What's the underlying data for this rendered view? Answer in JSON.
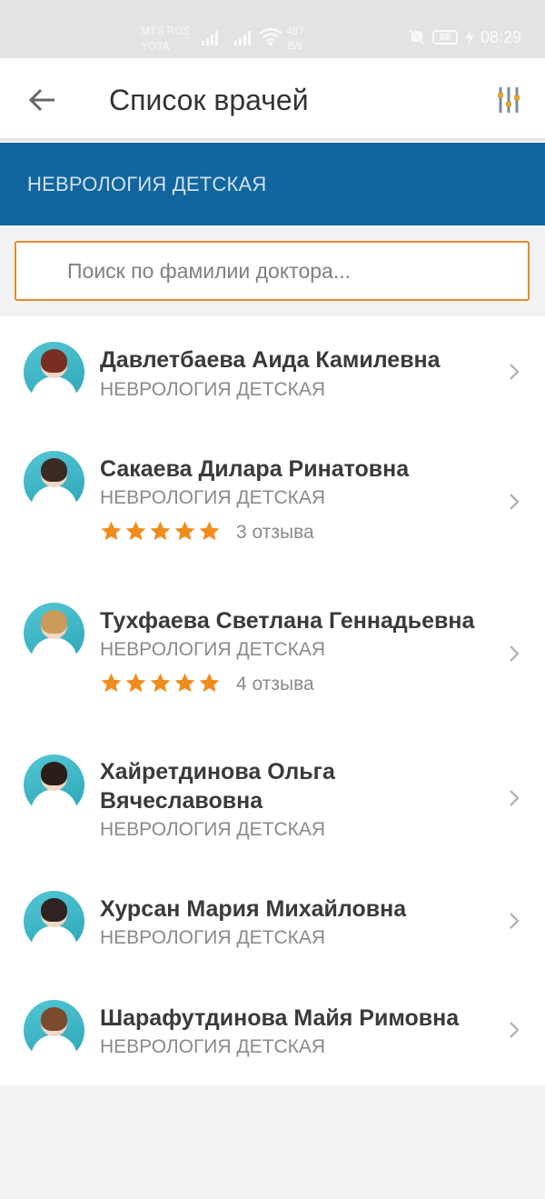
{
  "status_bar": {
    "carrier_line1": "MTS RUS",
    "carrier_line2": "YOTA",
    "speed_value": "487",
    "speed_unit": "B/s",
    "battery": "88",
    "time": "08:29"
  },
  "app_bar": {
    "title": "Список врачей",
    "back_icon": "arrow-left-icon",
    "filter_icon": "filter-sliders-icon"
  },
  "section": {
    "title": "НЕВРОЛОГИЯ ДЕТСКАЯ"
  },
  "search": {
    "placeholder": "Поиск по фамилии доктора..."
  },
  "colors": {
    "accent_blue": "#11669e",
    "accent_orange": "#e58a2c",
    "star": "#f08c1c"
  },
  "doctors": [
    {
      "name": "Давлетбаева Аида Камилевна",
      "specialty": "НЕВРОЛОГИЯ ДЕТСКАЯ",
      "reviews": ""
    },
    {
      "name": "Сакаева Дилара Ринатовна",
      "specialty": "НЕВРОЛОГИЯ ДЕТСКАЯ",
      "rating": 5,
      "reviews": "3 отзыва"
    },
    {
      "name": "Тухфаева Светлана Геннадьевна",
      "specialty": "НЕВРОЛОГИЯ ДЕТСКАЯ",
      "rating": 5,
      "reviews": "4 отзыва"
    },
    {
      "name_line1": "Хайретдинова Ольга",
      "name_line2": "Вячеславовна",
      "specialty": "НЕВРОЛОГИЯ ДЕТСКАЯ",
      "reviews": ""
    },
    {
      "name": "Хурсан Мария Михайловна",
      "specialty": "НЕВРОЛОГИЯ ДЕТСКАЯ",
      "reviews": ""
    },
    {
      "name": "Шарафутдинова Майя Римовна",
      "specialty": "НЕВРОЛОГИЯ ДЕТСКАЯ",
      "reviews": ""
    }
  ]
}
